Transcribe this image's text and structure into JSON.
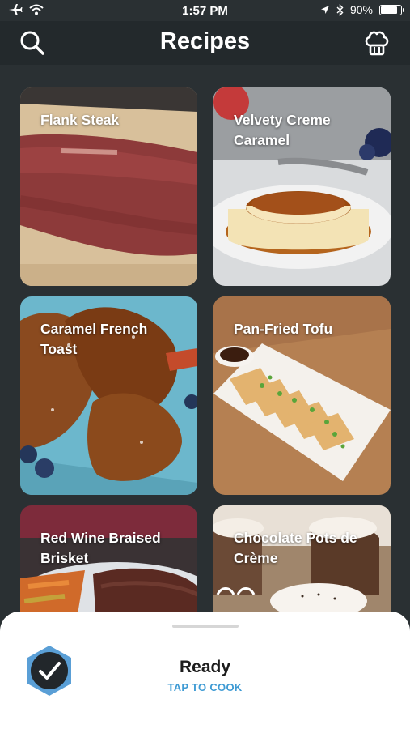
{
  "status_bar": {
    "time": "1:57 PM",
    "battery_text": "90%",
    "battery_level": 0.9,
    "left_icons": [
      "airplane-icon",
      "wifi-icon"
    ],
    "right_icons": [
      "location-icon",
      "bluetooth-icon"
    ]
  },
  "header": {
    "title": "Recipes",
    "left_icon": "search-icon",
    "right_icon": "chef-hat-icon"
  },
  "recipes": [
    {
      "title": "Flank Steak"
    },
    {
      "title": "Velvety Creme Caramel"
    },
    {
      "title": "Caramel French Toast"
    },
    {
      "title": "Pan-Fried Tofu"
    },
    {
      "title": "Red Wine Braised Brisket"
    },
    {
      "title": "Chocolate Pots de Crème"
    }
  ],
  "bottom_sheet": {
    "status": "Ready",
    "action": "TAP TO COOK",
    "badge_icon": "checkmark-icon",
    "accent_color": "#3f9bd4"
  }
}
